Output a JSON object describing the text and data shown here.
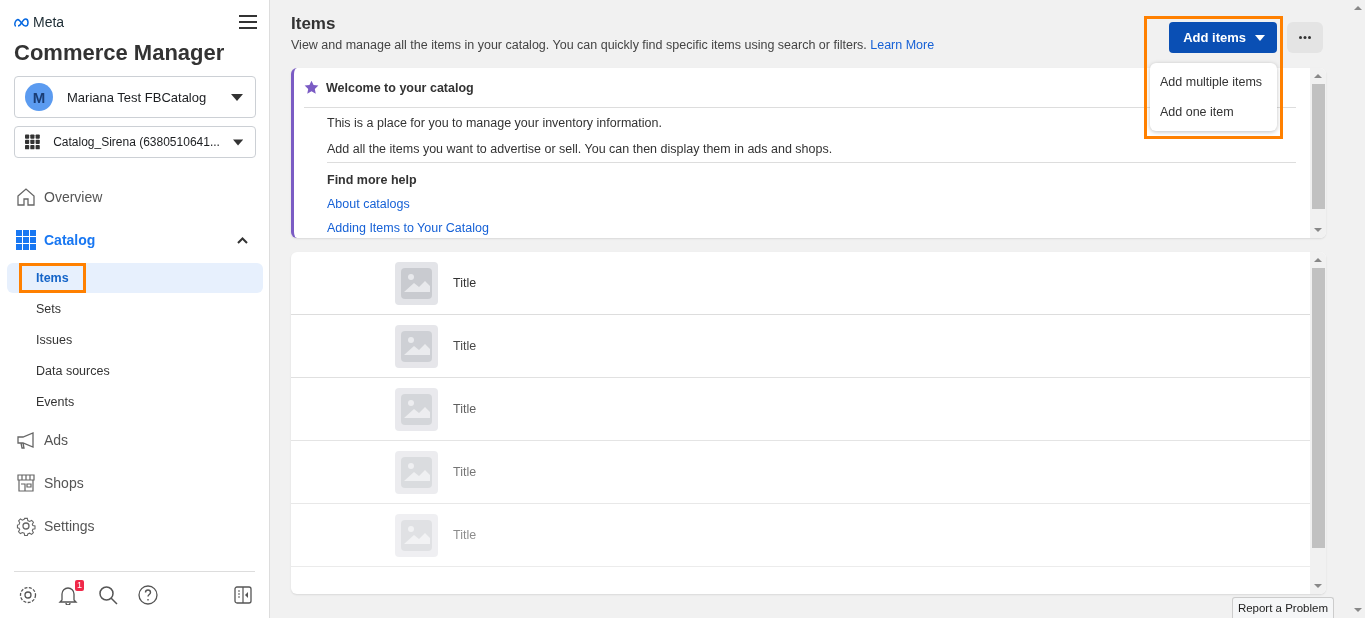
{
  "brand": {
    "logo": "Meta",
    "title": "Commerce Manager"
  },
  "account": {
    "initial": "M",
    "name": "Mariana Test FBCatalog"
  },
  "catalog_selector": {
    "name": "Catalog_Sirena (6380510641..."
  },
  "nav": [
    {
      "kind": "item",
      "label": "Overview",
      "selected": false
    },
    {
      "kind": "section",
      "label": "Catalog",
      "selected": true,
      "expanded": true,
      "children": [
        {
          "label": "Items",
          "selected": true,
          "highlighted": true
        },
        {
          "label": "Sets",
          "selected": false,
          "highlighted": false
        },
        {
          "label": "Issues",
          "selected": false,
          "highlighted": false
        },
        {
          "label": "Data sources",
          "selected": false,
          "highlighted": false
        },
        {
          "label": "Events",
          "selected": false,
          "highlighted": false
        }
      ]
    },
    {
      "kind": "item",
      "label": "Ads",
      "selected": false
    },
    {
      "kind": "item",
      "label": "Shops",
      "selected": false
    },
    {
      "kind": "item",
      "label": "Settings",
      "selected": false
    }
  ],
  "footer": {
    "notification_count": "1"
  },
  "header": {
    "title": "Items",
    "description": "View and manage all the items in your catalog. You can quickly find specific items using search or filters.",
    "link": "Learn More"
  },
  "add_items": {
    "label": "Add items",
    "highlighted": true,
    "expanded": true,
    "menu": [
      "Add multiple items",
      "Add one item"
    ]
  },
  "welcome": {
    "title": "Welcome to your catalog",
    "paragraphs": [
      "This is a place for you to manage your inventory information.",
      "Add all the items you want to advertise or sell. You can then display them in ads and shops."
    ],
    "help_title": "Find more help",
    "links": [
      "About catalogs",
      "Adding Items to Your Catalog"
    ]
  },
  "items": [
    {
      "title": "Title"
    },
    {
      "title": "Title"
    },
    {
      "title": "Title"
    },
    {
      "title": "Title"
    },
    {
      "title": "Title"
    }
  ],
  "report_button": "Report a Problem"
}
